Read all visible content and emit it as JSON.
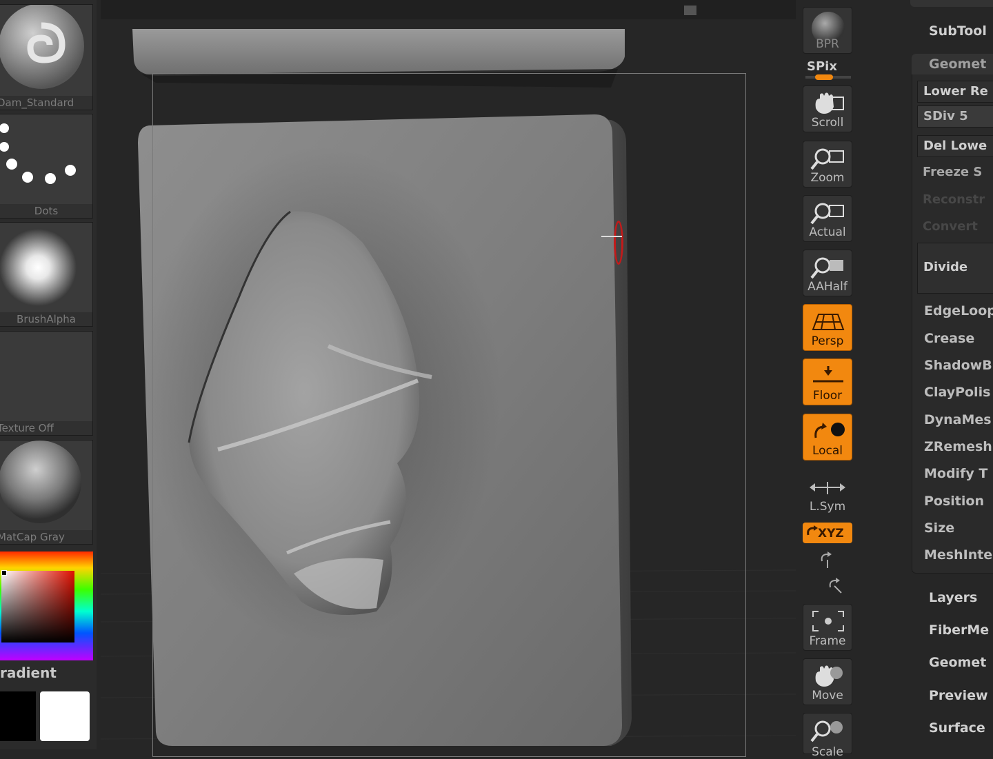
{
  "left_shelf": {
    "brush_label": "Dam_Standard",
    "stroke_label": "Dots",
    "alpha_label": "BrushAlpha",
    "texture_label": "Texture Off",
    "material_label": "MatCap Gray",
    "gradient_label": "radient"
  },
  "dock": {
    "bpr": "BPR",
    "spix": "SPix",
    "scroll": "Scroll",
    "zoom": "Zoom",
    "actual": "Actual",
    "aahalf": "AAHalf",
    "persp": "Persp",
    "floor": "Floor",
    "local": "Local",
    "lsym": "L.Sym",
    "xyz": "XYZ",
    "frame": "Frame",
    "move": "Move",
    "scale": "Scale"
  },
  "subtool_panel": {
    "title": "SubTool",
    "geometry_header": "Geomet",
    "lower_res": "Lower Re",
    "sdiv": "SDiv 5",
    "del_lower": "Del Lowe",
    "freeze": "Freeze S",
    "reconstruct": "Reconstr",
    "convert": "Convert",
    "divide": "Divide",
    "items": [
      "EdgeLoop",
      "Crease",
      "ShadowB",
      "ClayPolis",
      "DynaMes",
      "ZRemesh",
      "Modify T",
      "Position",
      "Size",
      "MeshInte"
    ],
    "sections": [
      "Layers",
      "FiberMe",
      "Geomet",
      "Preview",
      "Surface"
    ]
  },
  "colors": {
    "accent_orange": "#f2880f",
    "panel_bg": "#262626",
    "button_bg": "#343434"
  }
}
